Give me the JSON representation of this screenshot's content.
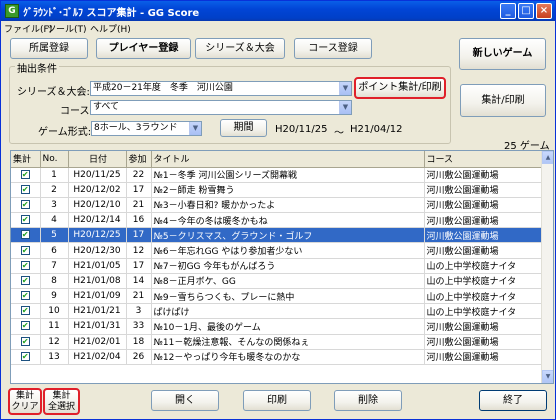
{
  "window": {
    "title": "ｸﾞﾗｳﾝﾄﾞ･ｺﾞﾙﾌ スコア集計 - GG Score",
    "icon": "golf-app-icon"
  },
  "menu": [
    "ファイル(F)",
    "ツール(T)",
    "ヘルプ(H)"
  ],
  "tabs": {
    "affiliation": "所属登録",
    "player": "プレイヤー登録",
    "series": "シリーズ＆大会",
    "course": "コース登録"
  },
  "new_game": "新しいゲーム",
  "filter": {
    "group_title": "抽出条件",
    "series_label": "シリーズ＆大会:",
    "series_value": "平成20－21年度　冬季　河川公園",
    "point_button": "ポイント集計/印刷",
    "course_label": "コース:",
    "course_value": "すべて",
    "format_label": "ゲーム形式:",
    "format_value": "8ホール、3ラウンド",
    "period_button": "期間",
    "period_from": "H20/11/25",
    "period_sep": "～",
    "period_to": "H21/04/12"
  },
  "aggregate_button": "集計/印刷",
  "game_count": "25 ゲーム",
  "table": {
    "headers": [
      "集計",
      "No.",
      "日付",
      "参加",
      "タイトル",
      "コース"
    ],
    "rows": [
      {
        "checked": true,
        "no": "1",
        "date": "H20/11/25",
        "count": "22",
        "title": "№1－冬季 河川公園シリーズ開幕戦",
        "course": "河川敷公園運動場"
      },
      {
        "checked": true,
        "no": "2",
        "date": "H20/12/02",
        "count": "17",
        "title": "№2－師走 粉雪舞う",
        "course": "河川敷公園運動場"
      },
      {
        "checked": true,
        "no": "3",
        "date": "H20/12/10",
        "count": "21",
        "title": "№3－小春日和? 暖かかったよ",
        "course": "河川敷公園運動場"
      },
      {
        "checked": true,
        "no": "4",
        "date": "H20/12/14",
        "count": "16",
        "title": "№4－今年の冬は暖冬かもね",
        "course": "河川敷公園運動場"
      },
      {
        "checked": true,
        "no": "5",
        "date": "H20/12/25",
        "count": "17",
        "title": "№5－クリスマス、グラウンド・ゴルフ",
        "course": "河川敷公園運動場",
        "selected": true
      },
      {
        "checked": true,
        "no": "6",
        "date": "H20/12/30",
        "count": "12",
        "title": "№6－年忘れGG やはり参加者少ない",
        "course": "河川敷公園運動場"
      },
      {
        "checked": true,
        "no": "7",
        "date": "H21/01/05",
        "count": "17",
        "title": "№7－初GG 今年もがんばろう",
        "course": "山の上中学校庭ナイタ"
      },
      {
        "checked": true,
        "no": "8",
        "date": "H21/01/08",
        "count": "14",
        "title": "№8－正月ボケ、GG",
        "course": "山の上中学校庭ナイタ"
      },
      {
        "checked": true,
        "no": "9",
        "date": "H21/01/09",
        "count": "21",
        "title": "№9－雪ちらつくも、プレーに熱中",
        "course": "山の上中学校庭ナイタ"
      },
      {
        "checked": true,
        "no": "10",
        "date": "H21/01/21",
        "count": "3",
        "title": "ぱけぱけ",
        "course": "山の上中学校庭ナイタ"
      },
      {
        "checked": true,
        "no": "11",
        "date": "H21/01/31",
        "count": "33",
        "title": "№10－1月、最後のゲーム",
        "course": "河川敷公園運動場"
      },
      {
        "checked": true,
        "no": "12",
        "date": "H21/02/01",
        "count": "18",
        "title": "№11－乾燥注意報、そんなの関係ねぇ",
        "course": "河川敷公園運動場"
      },
      {
        "checked": true,
        "no": "13",
        "date": "H21/02/04",
        "count": "26",
        "title": "№12－やっぱり今年も暖冬なのかな",
        "course": "河川敷公園運動場"
      }
    ]
  },
  "bottom": {
    "clear_line1": "集計",
    "clear_line2": "クリア",
    "all_line1": "集計",
    "all_line2": "全選択",
    "open": "開く",
    "print": "印刷",
    "delete": "削除",
    "exit": "終了"
  }
}
